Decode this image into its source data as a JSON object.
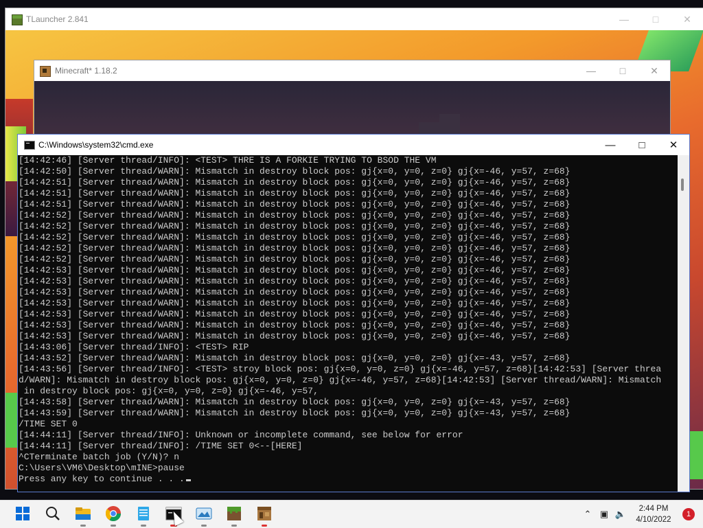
{
  "tlauncher": {
    "title": "TLauncher 2.841"
  },
  "minecraft": {
    "title": "Minecraft* 1.18.2"
  },
  "cmd": {
    "title": "C:\\Windows\\system32\\cmd.exe",
    "lines": [
      "[14:42:46] [Server thread/INFO]: <TEST> THRE IS A FORKIE TRYING TO BSOD THE VM",
      "[14:42:50] [Server thread/WARN]: Mismatch in destroy block pos: gj{x=0, y=0, z=0} gj{x=-46, y=57, z=68}",
      "[14:42:51] [Server thread/WARN]: Mismatch in destroy block pos: gj{x=0, y=0, z=0} gj{x=-46, y=57, z=68}",
      "[14:42:51] [Server thread/WARN]: Mismatch in destroy block pos: gj{x=0, y=0, z=0} gj{x=-46, y=57, z=68}",
      "[14:42:51] [Server thread/WARN]: Mismatch in destroy block pos: gj{x=0, y=0, z=0} gj{x=-46, y=57, z=68}",
      "[14:42:52] [Server thread/WARN]: Mismatch in destroy block pos: gj{x=0, y=0, z=0} gj{x=-46, y=57, z=68}",
      "[14:42:52] [Server thread/WARN]: Mismatch in destroy block pos: gj{x=0, y=0, z=0} gj{x=-46, y=57, z=68}",
      "[14:42:52] [Server thread/WARN]: Mismatch in destroy block pos: gj{x=0, y=0, z=0} gj{x=-46, y=57, z=68}",
      "[14:42:52] [Server thread/WARN]: Mismatch in destroy block pos: gj{x=0, y=0, z=0} gj{x=-46, y=57, z=68}",
      "[14:42:52] [Server thread/WARN]: Mismatch in destroy block pos: gj{x=0, y=0, z=0} gj{x=-46, y=57, z=68}",
      "[14:42:53] [Server thread/WARN]: Mismatch in destroy block pos: gj{x=0, y=0, z=0} gj{x=-46, y=57, z=68}",
      "[14:42:53] [Server thread/WARN]: Mismatch in destroy block pos: gj{x=0, y=0, z=0} gj{x=-46, y=57, z=68}",
      "[14:42:53] [Server thread/WARN]: Mismatch in destroy block pos: gj{x=0, y=0, z=0} gj{x=-46, y=57, z=68}",
      "[14:42:53] [Server thread/WARN]: Mismatch in destroy block pos: gj{x=0, y=0, z=0} gj{x=-46, y=57, z=68}",
      "[14:42:53] [Server thread/WARN]: Mismatch in destroy block pos: gj{x=0, y=0, z=0} gj{x=-46, y=57, z=68}",
      "[14:42:53] [Server thread/WARN]: Mismatch in destroy block pos: gj{x=0, y=0, z=0} gj{x=-46, y=57, z=68}",
      "[14:42:53] [Server thread/WARN]: Mismatch in destroy block pos: gj{x=0, y=0, z=0} gj{x=-46, y=57, z=68}",
      "[14:43:06] [Server thread/INFO]: <TEST> RIP",
      "[14:43:52] [Server thread/WARN]: Mismatch in destroy block pos: gj{x=0, y=0, z=0} gj{x=-43, y=57, z=68}",
      "[14:43:56] [Server thread/INFO]: <TEST> stroy block pos: gj{x=0, y=0, z=0} gj{x=-46, y=57, z=68}[14:42:53] [Server threa",
      "d/WARN]: Mismatch in destroy block pos: gj{x=0, y=0, z=0} gj{x=-46, y=57, z=68}[14:42:53] [Server thread/WARN]: Mismatch",
      " in destroy block pos: gj{x=0, y=0, z=0} gj{x=-46, y=57,",
      "[14:43:58] [Server thread/WARN]: Mismatch in destroy block pos: gj{x=0, y=0, z=0} gj{x=-43, y=57, z=68}",
      "[14:43:59] [Server thread/WARN]: Mismatch in destroy block pos: gj{x=0, y=0, z=0} gj{x=-43, y=57, z=68}",
      "/TIME SET 0",
      "[14:44:11] [Server thread/INFO]: Unknown or incomplete command, see below for error",
      "[14:44:11] [Server thread/INFO]: /TIME SET 0<--[HERE]",
      "^CTerminate batch job (Y/N)? n",
      "",
      "C:\\Users\\VM6\\Desktop\\mINE>pause",
      "Press any key to continue . . ."
    ]
  },
  "taskbar": {
    "apps": [
      {
        "name": "start-button",
        "icon": "windows-logo-icon"
      },
      {
        "name": "search-button",
        "icon": "search-icon"
      },
      {
        "name": "file-explorer",
        "icon": "folder-icon"
      },
      {
        "name": "chrome",
        "icon": "chrome-icon"
      },
      {
        "name": "notepad",
        "icon": "notepad-icon"
      },
      {
        "name": "cmd",
        "icon": "terminal-icon"
      },
      {
        "name": "photos",
        "icon": "photos-icon"
      },
      {
        "name": "minecraft-launcher",
        "icon": "grass-block-icon"
      },
      {
        "name": "minecraft",
        "icon": "crafting-table-icon"
      }
    ],
    "time": "2:44 PM",
    "date": "4/10/2022",
    "notification_count": "1"
  }
}
